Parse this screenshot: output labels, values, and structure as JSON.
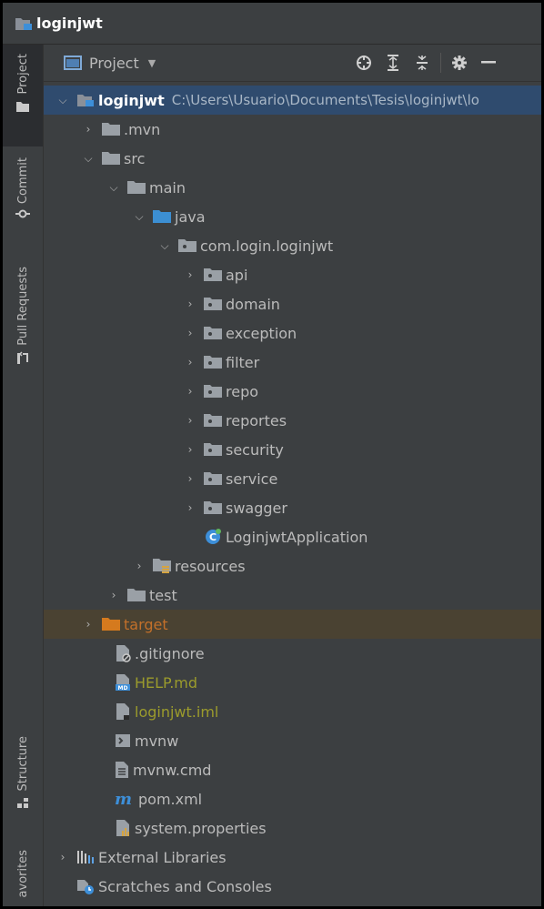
{
  "window": {
    "title": "loginjwt"
  },
  "toolstrip": {
    "project": "Project",
    "commit": "Commit",
    "pull_requests": "Pull Requests",
    "structure": "Structure",
    "favorites": "avorites"
  },
  "panel": {
    "view_label": "Project"
  },
  "tree": {
    "root_name": "loginjwt",
    "root_path": "C:\\Users\\Usuario\\Documents\\Tesis\\loginjwt\\lo",
    "mvn": ".mvn",
    "src": "src",
    "main": "main",
    "java": "java",
    "package": "com.login.loginjwt",
    "packages": [
      "api",
      "domain",
      "exception",
      "filter",
      "repo",
      "reportes",
      "security",
      "service",
      "swagger"
    ],
    "app_class": "LoginjwtApplication",
    "resources": "resources",
    "test": "test",
    "target": "target",
    "gitignore": ".gitignore",
    "help": "HELP.md",
    "iml": "loginjwt.iml",
    "mvnw": "mvnw",
    "mvnw_cmd": "mvnw.cmd",
    "pom": "pom.xml",
    "system_properties": "system.properties",
    "external_libraries": "External Libraries",
    "scratches": "Scratches and Consoles"
  },
  "colors": {
    "background": "#3c3f41",
    "selected_row": "#2f4b6e",
    "excluded_row": "#4a4232",
    "modified_text": "#9b9b2c",
    "excluded_text": "#c3702a"
  }
}
